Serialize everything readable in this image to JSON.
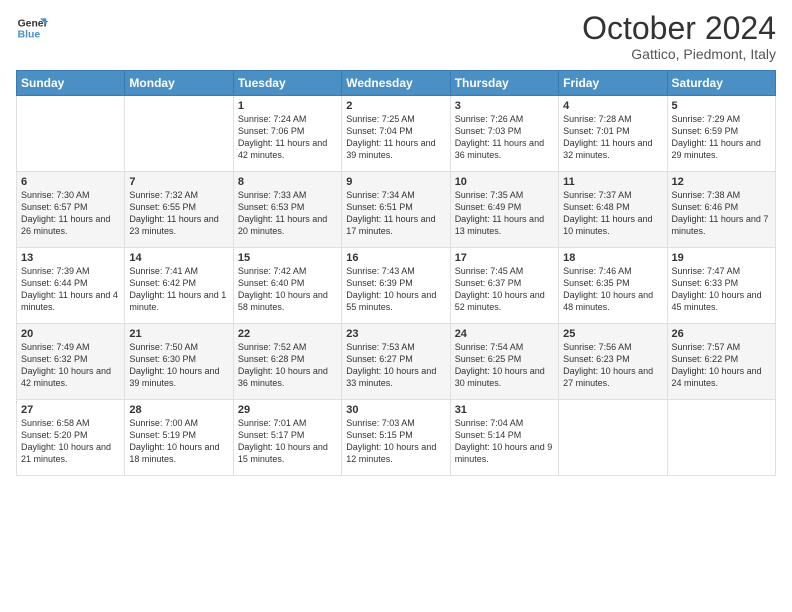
{
  "header": {
    "logo_line1": "General",
    "logo_line2": "Blue",
    "month_title": "October 2024",
    "location": "Gattico, Piedmont, Italy"
  },
  "weekdays": [
    "Sunday",
    "Monday",
    "Tuesday",
    "Wednesday",
    "Thursday",
    "Friday",
    "Saturday"
  ],
  "rows": [
    [
      {
        "day": "",
        "content": ""
      },
      {
        "day": "",
        "content": ""
      },
      {
        "day": "1",
        "content": "Sunrise: 7:24 AM\nSunset: 7:06 PM\nDaylight: 11 hours and 42 minutes."
      },
      {
        "day": "2",
        "content": "Sunrise: 7:25 AM\nSunset: 7:04 PM\nDaylight: 11 hours and 39 minutes."
      },
      {
        "day": "3",
        "content": "Sunrise: 7:26 AM\nSunset: 7:03 PM\nDaylight: 11 hours and 36 minutes."
      },
      {
        "day": "4",
        "content": "Sunrise: 7:28 AM\nSunset: 7:01 PM\nDaylight: 11 hours and 32 minutes."
      },
      {
        "day": "5",
        "content": "Sunrise: 7:29 AM\nSunset: 6:59 PM\nDaylight: 11 hours and 29 minutes."
      }
    ],
    [
      {
        "day": "6",
        "content": "Sunrise: 7:30 AM\nSunset: 6:57 PM\nDaylight: 11 hours and 26 minutes."
      },
      {
        "day": "7",
        "content": "Sunrise: 7:32 AM\nSunset: 6:55 PM\nDaylight: 11 hours and 23 minutes."
      },
      {
        "day": "8",
        "content": "Sunrise: 7:33 AM\nSunset: 6:53 PM\nDaylight: 11 hours and 20 minutes."
      },
      {
        "day": "9",
        "content": "Sunrise: 7:34 AM\nSunset: 6:51 PM\nDaylight: 11 hours and 17 minutes."
      },
      {
        "day": "10",
        "content": "Sunrise: 7:35 AM\nSunset: 6:49 PM\nDaylight: 11 hours and 13 minutes."
      },
      {
        "day": "11",
        "content": "Sunrise: 7:37 AM\nSunset: 6:48 PM\nDaylight: 11 hours and 10 minutes."
      },
      {
        "day": "12",
        "content": "Sunrise: 7:38 AM\nSunset: 6:46 PM\nDaylight: 11 hours and 7 minutes."
      }
    ],
    [
      {
        "day": "13",
        "content": "Sunrise: 7:39 AM\nSunset: 6:44 PM\nDaylight: 11 hours and 4 minutes."
      },
      {
        "day": "14",
        "content": "Sunrise: 7:41 AM\nSunset: 6:42 PM\nDaylight: 11 hours and 1 minute."
      },
      {
        "day": "15",
        "content": "Sunrise: 7:42 AM\nSunset: 6:40 PM\nDaylight: 10 hours and 58 minutes."
      },
      {
        "day": "16",
        "content": "Sunrise: 7:43 AM\nSunset: 6:39 PM\nDaylight: 10 hours and 55 minutes."
      },
      {
        "day": "17",
        "content": "Sunrise: 7:45 AM\nSunset: 6:37 PM\nDaylight: 10 hours and 52 minutes."
      },
      {
        "day": "18",
        "content": "Sunrise: 7:46 AM\nSunset: 6:35 PM\nDaylight: 10 hours and 48 minutes."
      },
      {
        "day": "19",
        "content": "Sunrise: 7:47 AM\nSunset: 6:33 PM\nDaylight: 10 hours and 45 minutes."
      }
    ],
    [
      {
        "day": "20",
        "content": "Sunrise: 7:49 AM\nSunset: 6:32 PM\nDaylight: 10 hours and 42 minutes."
      },
      {
        "day": "21",
        "content": "Sunrise: 7:50 AM\nSunset: 6:30 PM\nDaylight: 10 hours and 39 minutes."
      },
      {
        "day": "22",
        "content": "Sunrise: 7:52 AM\nSunset: 6:28 PM\nDaylight: 10 hours and 36 minutes."
      },
      {
        "day": "23",
        "content": "Sunrise: 7:53 AM\nSunset: 6:27 PM\nDaylight: 10 hours and 33 minutes."
      },
      {
        "day": "24",
        "content": "Sunrise: 7:54 AM\nSunset: 6:25 PM\nDaylight: 10 hours and 30 minutes."
      },
      {
        "day": "25",
        "content": "Sunrise: 7:56 AM\nSunset: 6:23 PM\nDaylight: 10 hours and 27 minutes."
      },
      {
        "day": "26",
        "content": "Sunrise: 7:57 AM\nSunset: 6:22 PM\nDaylight: 10 hours and 24 minutes."
      }
    ],
    [
      {
        "day": "27",
        "content": "Sunrise: 6:58 AM\nSunset: 5:20 PM\nDaylight: 10 hours and 21 minutes."
      },
      {
        "day": "28",
        "content": "Sunrise: 7:00 AM\nSunset: 5:19 PM\nDaylight: 10 hours and 18 minutes."
      },
      {
        "day": "29",
        "content": "Sunrise: 7:01 AM\nSunset: 5:17 PM\nDaylight: 10 hours and 15 minutes."
      },
      {
        "day": "30",
        "content": "Sunrise: 7:03 AM\nSunset: 5:15 PM\nDaylight: 10 hours and 12 minutes."
      },
      {
        "day": "31",
        "content": "Sunrise: 7:04 AM\nSunset: 5:14 PM\nDaylight: 10 hours and 9 minutes."
      },
      {
        "day": "",
        "content": ""
      },
      {
        "day": "",
        "content": ""
      }
    ]
  ]
}
